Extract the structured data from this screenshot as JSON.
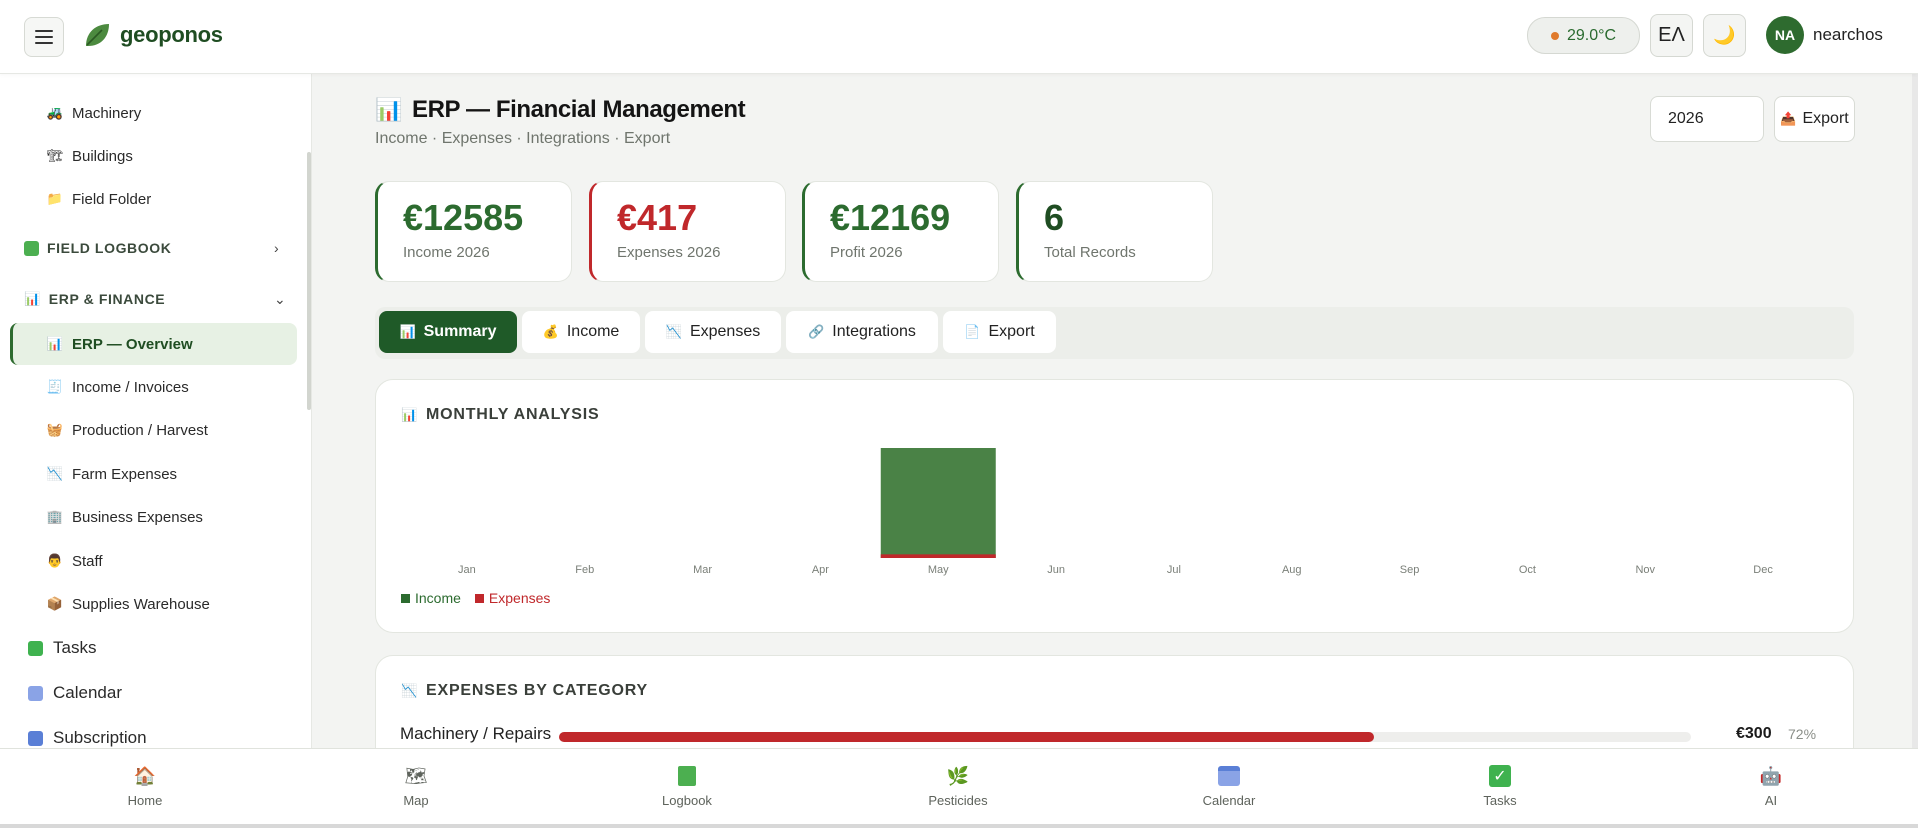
{
  "header": {
    "brand": "geoponos",
    "temperature": "29.0°C",
    "language_toggle": "ΕΛ",
    "user_initials": "NA",
    "user_name": "nearchos"
  },
  "sidebar": {
    "items_top": [
      {
        "label": "Machinery",
        "icon": "tractor-icon"
      },
      {
        "label": "Buildings",
        "icon": "building-icon"
      },
      {
        "label": "Field Folder",
        "icon": "folder-icon"
      }
    ],
    "section_logbook": "FIELD LOGBOOK",
    "section_erp": "ERP & FINANCE",
    "erp_items": [
      {
        "label": "ERP — Overview",
        "icon": "chart-icon"
      },
      {
        "label": "Income / Invoices",
        "icon": "invoice-icon"
      },
      {
        "label": "Production / Harvest",
        "icon": "basket-icon"
      },
      {
        "label": "Farm Expenses",
        "icon": "chart-down-icon"
      },
      {
        "label": "Business Expenses",
        "icon": "office-icon"
      },
      {
        "label": "Staff",
        "icon": "worker-icon"
      },
      {
        "label": "Supplies Warehouse",
        "icon": "box-icon"
      }
    ],
    "bottom_items": [
      {
        "label": "Tasks",
        "icon": "check-icon"
      },
      {
        "label": "Calendar",
        "icon": "calendar-icon"
      },
      {
        "label": "Subscription",
        "icon": "card-icon"
      }
    ]
  },
  "main": {
    "title": "ERP — Financial Management",
    "subtitle": "Income · Expenses · Integrations · Export",
    "year": "2026",
    "export_label": "Export",
    "kpis": [
      {
        "value": "€12585",
        "label": "Income 2026",
        "color": "#2c6b2f"
      },
      {
        "value": "€417",
        "label": "Expenses 2026",
        "color": "#c0282b"
      },
      {
        "value": "€12169",
        "label": "Profit 2026",
        "color": "#2c6b2f"
      },
      {
        "value": "6",
        "label": "Total Records",
        "color": "#1f4d22"
      }
    ],
    "tabs": [
      {
        "label": "Summary"
      },
      {
        "label": "Income"
      },
      {
        "label": "Expenses"
      },
      {
        "label": "Integrations"
      },
      {
        "label": "Export"
      }
    ],
    "monthly_title": "MONTHLY ANALYSIS",
    "expenses_title": "EXPENSES BY CATEGORY",
    "category": {
      "label": "Machinery / Repairs",
      "value": "€300",
      "percent_label": "72%",
      "fraction": 0.72
    }
  },
  "chart_data": {
    "type": "bar",
    "categories": [
      "Jan",
      "Feb",
      "Mar",
      "Apr",
      "May",
      "Jun",
      "Jul",
      "Aug",
      "Sep",
      "Oct",
      "Nov",
      "Dec"
    ],
    "series": [
      {
        "name": "Income",
        "values": [
          0,
          0,
          0,
          0,
          12585,
          0,
          0,
          0,
          0,
          0,
          0,
          0
        ],
        "color": "#4a8246"
      },
      {
        "name": "Expenses",
        "values": [
          0,
          0,
          0,
          0,
          417,
          0,
          0,
          0,
          0,
          0,
          0,
          0
        ],
        "color": "#c0282b"
      }
    ],
    "legend": "bottom-left"
  },
  "bottom_nav": [
    {
      "label": "Home",
      "icon": "home-icon"
    },
    {
      "label": "Map",
      "icon": "map-icon"
    },
    {
      "label": "Logbook",
      "icon": "logbook-icon"
    },
    {
      "label": "Pesticides",
      "icon": "plant-icon"
    },
    {
      "label": "Calendar",
      "icon": "calendar-icon"
    },
    {
      "label": "Tasks",
      "icon": "check-icon"
    },
    {
      "label": "AI",
      "icon": "robot-icon"
    }
  ]
}
